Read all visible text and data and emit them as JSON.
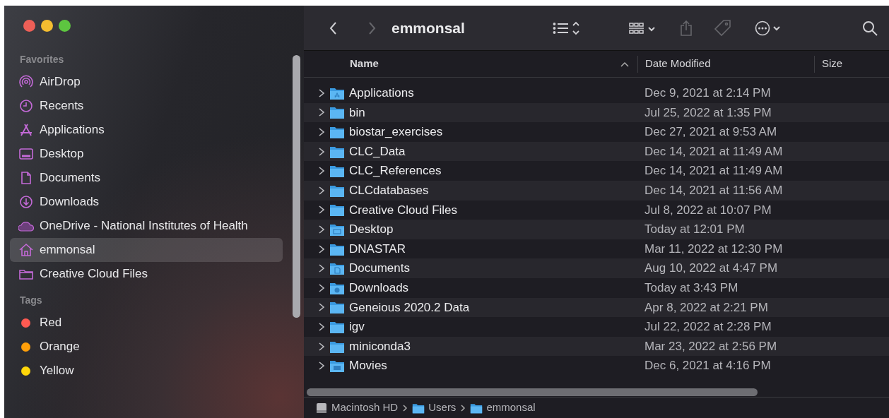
{
  "sidebar": {
    "sections": [
      {
        "title": "Favorites",
        "items": [
          {
            "label": "AirDrop",
            "kind": "airdrop",
            "selected": false
          },
          {
            "label": "Recents",
            "kind": "clock",
            "selected": false
          },
          {
            "label": "Applications",
            "kind": "apps",
            "selected": false
          },
          {
            "label": "Desktop",
            "kind": "desktop",
            "selected": false
          },
          {
            "label": "Documents",
            "kind": "document",
            "selected": false
          },
          {
            "label": "Downloads",
            "kind": "download",
            "selected": false
          },
          {
            "label": "OneDrive - National Institutes of Health",
            "kind": "cloud",
            "selected": false
          },
          {
            "label": "emmonsal",
            "kind": "home",
            "selected": true
          },
          {
            "label": "Creative Cloud Files",
            "kind": "folder",
            "selected": false
          }
        ]
      },
      {
        "title": "Tags",
        "items": [
          {
            "label": "Red",
            "kind": "tag",
            "color": "#ff5a52",
            "selected": false
          },
          {
            "label": "Orange",
            "kind": "tag",
            "color": "#ff9f0a",
            "selected": false
          },
          {
            "label": "Yellow",
            "kind": "tag",
            "color": "#ffd60a",
            "selected": false
          }
        ]
      }
    ]
  },
  "toolbar": {
    "title": "emmonsal",
    "buttons": [
      {
        "kind": "back",
        "disabled": false
      },
      {
        "kind": "forward",
        "disabled": true
      },
      {
        "kind": "list-view",
        "disabled": false
      },
      {
        "kind": "grid-view",
        "disabled": false
      },
      {
        "kind": "share",
        "disabled": true
      },
      {
        "kind": "tag",
        "disabled": true
      },
      {
        "kind": "more",
        "disabled": false
      },
      {
        "kind": "search",
        "disabled": false
      }
    ]
  },
  "table": {
    "columns": [
      {
        "label": "Name",
        "sorted": true
      },
      {
        "label": "Date Modified",
        "sorted": false
      },
      {
        "label": "Size",
        "sorted": false
      }
    ],
    "rows": [
      {
        "name": "Applications",
        "kind": "applications",
        "date": "Dec 9, 2021 at 2:14 PM"
      },
      {
        "name": "bin",
        "kind": "plain",
        "date": "Jul 25, 2022 at 1:35 PM"
      },
      {
        "name": "biostar_exercises",
        "kind": "plain",
        "date": "Dec 27, 2021 at 9:53 AM"
      },
      {
        "name": "CLC_Data",
        "kind": "plain",
        "date": "Dec 14, 2021 at 11:49 AM"
      },
      {
        "name": "CLC_References",
        "kind": "plain",
        "date": "Dec 14, 2021 at 11:49 AM"
      },
      {
        "name": "CLCdatabases",
        "kind": "plain",
        "date": "Dec 14, 2021 at 11:56 AM"
      },
      {
        "name": "Creative Cloud Files",
        "kind": "plain",
        "date": "Jul 8, 2022 at 10:07 PM"
      },
      {
        "name": "Desktop",
        "kind": "desktop",
        "date": "Today at 12:01 PM"
      },
      {
        "name": "DNASTAR",
        "kind": "plain",
        "date": "Mar 11, 2022 at 12:30 PM"
      },
      {
        "name": "Documents",
        "kind": "documents",
        "date": "Aug 10, 2022 at 4:47 PM"
      },
      {
        "name": "Downloads",
        "kind": "downloads",
        "date": "Today at 3:43 PM"
      },
      {
        "name": "Geneious 2020.2 Data",
        "kind": "plain",
        "date": "Apr 8, 2022 at 2:21 PM"
      },
      {
        "name": "igv",
        "kind": "plain",
        "date": "Jul 22, 2022 at 2:28 PM"
      },
      {
        "name": "miniconda3",
        "kind": "plain",
        "date": "Mar 23, 2022 at 2:56 PM"
      },
      {
        "name": "Movies",
        "kind": "movies",
        "date": "Dec 6, 2021 at 4:16 PM"
      }
    ]
  },
  "path_bar": [
    {
      "label": "Macintosh HD",
      "kind": "disk"
    },
    {
      "label": "Users",
      "kind": "users"
    },
    {
      "label": "emmonsal",
      "kind": "home"
    }
  ]
}
